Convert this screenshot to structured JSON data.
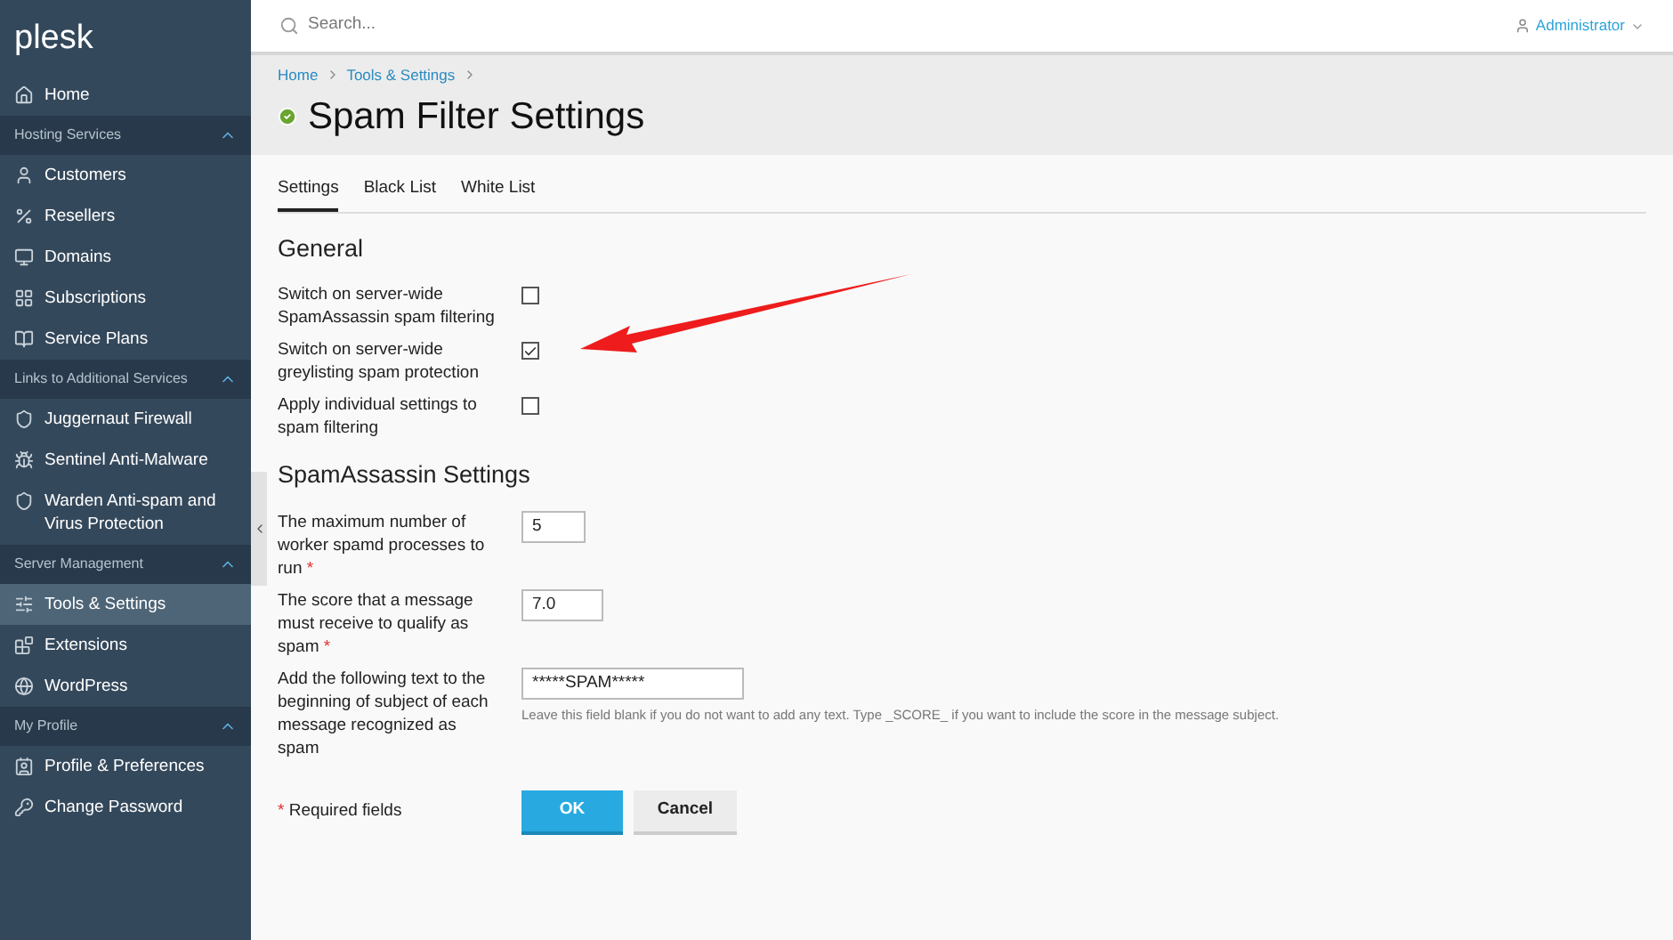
{
  "sidebar": {
    "logo": "plesk",
    "items": [
      {
        "kind": "item",
        "label": "Home",
        "selected": false
      },
      {
        "kind": "section",
        "label": "Hosting Services",
        "expanded": true
      },
      {
        "kind": "item",
        "label": "Customers",
        "selected": false
      },
      {
        "kind": "item",
        "label": "Resellers",
        "selected": false
      },
      {
        "kind": "item",
        "label": "Domains",
        "selected": false
      },
      {
        "kind": "item",
        "label": "Subscriptions",
        "selected": false
      },
      {
        "kind": "item",
        "label": "Service Plans",
        "selected": false
      },
      {
        "kind": "section",
        "label": "Links to Additional Services",
        "expanded": true
      },
      {
        "kind": "item",
        "label": "Juggernaut Firewall",
        "selected": false
      },
      {
        "kind": "item",
        "label": "Sentinel Anti-Malware",
        "selected": false
      },
      {
        "kind": "item",
        "label": "Warden Anti-spam and Virus Protection",
        "selected": false
      },
      {
        "kind": "section",
        "label": "Server Management",
        "expanded": true
      },
      {
        "kind": "item",
        "label": "Tools & Settings",
        "selected": true
      },
      {
        "kind": "item",
        "label": "Extensions",
        "selected": false
      },
      {
        "kind": "item",
        "label": "WordPress",
        "selected": false
      },
      {
        "kind": "section",
        "label": "My Profile",
        "expanded": true
      },
      {
        "kind": "item",
        "label": "Profile & Preferences",
        "selected": false
      },
      {
        "kind": "item",
        "label": "Change Password",
        "selected": false
      }
    ]
  },
  "search": {
    "placeholder": "Search..."
  },
  "user": {
    "name": "Administrator"
  },
  "breadcrumbs": [
    "Home",
    "Tools & Settings"
  ],
  "page_title": "Spam Filter Settings",
  "tabs": [
    {
      "label": "Settings",
      "selected": true
    },
    {
      "label": "Black List",
      "selected": false
    },
    {
      "label": "White List",
      "selected": false
    }
  ],
  "sections": [
    {
      "title": "General",
      "fields": [
        {
          "kind": "checkbox",
          "label": "Switch on server-wide SpamAssassin spam filtering",
          "checked": false
        },
        {
          "kind": "checkbox",
          "label": "Switch on server-wide greylisting spam protection",
          "checked": true,
          "annotated": true
        },
        {
          "kind": "checkbox",
          "label": "Apply individual settings to spam filtering",
          "checked": false
        }
      ]
    },
    {
      "title": "SpamAssassin Settings",
      "fields": [
        {
          "kind": "text",
          "label": "The maximum number of worker spamd processes to run",
          "required_mark": "*",
          "value": "5"
        },
        {
          "kind": "text",
          "label": "The score that a message must receive to qualify as spam",
          "required_mark": "*",
          "value": "7.0"
        },
        {
          "kind": "text",
          "label": "Add the following text to the beginning of subject of each message recognized as spam",
          "value": "*****SPAM*****",
          "hint": "Leave this field blank if you do not want to add any text. Type _SCORE_ if you want to include the score in the message subject."
        }
      ]
    }
  ],
  "required_note": {
    "mark": "*",
    "text": "Required fields"
  },
  "buttons": [
    {
      "kind": "primary",
      "label": "OK"
    },
    {
      "kind": "secondary",
      "label": "Cancel"
    }
  ]
}
